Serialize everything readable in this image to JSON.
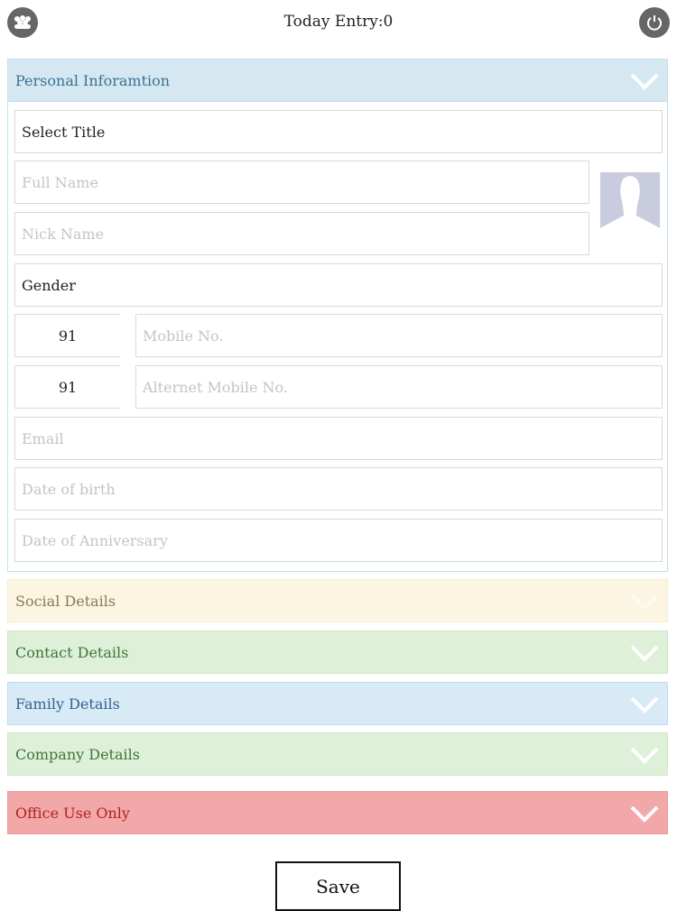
{
  "header": {
    "title": "Today Entry:0",
    "left_icon": "people-group-icon",
    "right_icon": "power-icon"
  },
  "personal": {
    "title": "Personal Inforamtion",
    "select_title": "Select Title",
    "full_name_placeholder": "Full Name",
    "nick_name_placeholder": "Nick Name",
    "gender": "Gender",
    "mobile_code": "91",
    "mobile_placeholder": "Mobile No.",
    "alt_mobile_code": "91",
    "alt_mobile_placeholder": "Alternet Mobile No.",
    "email_placeholder": "Email",
    "dob_placeholder": "Date of birth",
    "anniversary_placeholder": "Date of Anniversary"
  },
  "sections": {
    "social": "Social Details",
    "contact": "Contact Details",
    "family": "Family Details",
    "company": "Company Details",
    "office": "Office Use Only"
  },
  "actions": {
    "save": "Save"
  },
  "colors": {
    "personal_bg": "#d5e8f1",
    "social_bg": "#fbf5e2",
    "contact_bg": "#dff0d8",
    "family_bg": "#d9eaf7",
    "company_bg": "#dff0d8",
    "office_bg": "#f2a8a8"
  }
}
